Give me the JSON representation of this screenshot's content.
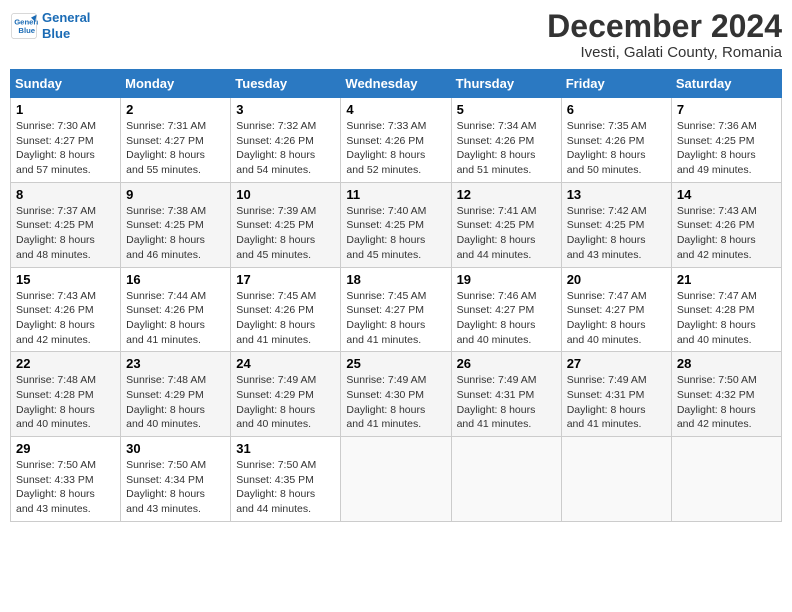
{
  "logo": {
    "line1": "General",
    "line2": "Blue"
  },
  "title": "December 2024",
  "location": "Ivesti, Galati County, Romania",
  "weekdays": [
    "Sunday",
    "Monday",
    "Tuesday",
    "Wednesday",
    "Thursday",
    "Friday",
    "Saturday"
  ],
  "weeks": [
    [
      {
        "day": "1",
        "sunrise": "7:30 AM",
        "sunset": "4:27 PM",
        "daylight": "8 hours and 57 minutes."
      },
      {
        "day": "2",
        "sunrise": "7:31 AM",
        "sunset": "4:27 PM",
        "daylight": "8 hours and 55 minutes."
      },
      {
        "day": "3",
        "sunrise": "7:32 AM",
        "sunset": "4:26 PM",
        "daylight": "8 hours and 54 minutes."
      },
      {
        "day": "4",
        "sunrise": "7:33 AM",
        "sunset": "4:26 PM",
        "daylight": "8 hours and 52 minutes."
      },
      {
        "day": "5",
        "sunrise": "7:34 AM",
        "sunset": "4:26 PM",
        "daylight": "8 hours and 51 minutes."
      },
      {
        "day": "6",
        "sunrise": "7:35 AM",
        "sunset": "4:26 PM",
        "daylight": "8 hours and 50 minutes."
      },
      {
        "day": "7",
        "sunrise": "7:36 AM",
        "sunset": "4:25 PM",
        "daylight": "8 hours and 49 minutes."
      }
    ],
    [
      {
        "day": "8",
        "sunrise": "7:37 AM",
        "sunset": "4:25 PM",
        "daylight": "8 hours and 48 minutes."
      },
      {
        "day": "9",
        "sunrise": "7:38 AM",
        "sunset": "4:25 PM",
        "daylight": "8 hours and 46 minutes."
      },
      {
        "day": "10",
        "sunrise": "7:39 AM",
        "sunset": "4:25 PM",
        "daylight": "8 hours and 45 minutes."
      },
      {
        "day": "11",
        "sunrise": "7:40 AM",
        "sunset": "4:25 PM",
        "daylight": "8 hours and 45 minutes."
      },
      {
        "day": "12",
        "sunrise": "7:41 AM",
        "sunset": "4:25 PM",
        "daylight": "8 hours and 44 minutes."
      },
      {
        "day": "13",
        "sunrise": "7:42 AM",
        "sunset": "4:25 PM",
        "daylight": "8 hours and 43 minutes."
      },
      {
        "day": "14",
        "sunrise": "7:43 AM",
        "sunset": "4:26 PM",
        "daylight": "8 hours and 42 minutes."
      }
    ],
    [
      {
        "day": "15",
        "sunrise": "7:43 AM",
        "sunset": "4:26 PM",
        "daylight": "8 hours and 42 minutes."
      },
      {
        "day": "16",
        "sunrise": "7:44 AM",
        "sunset": "4:26 PM",
        "daylight": "8 hours and 41 minutes."
      },
      {
        "day": "17",
        "sunrise": "7:45 AM",
        "sunset": "4:26 PM",
        "daylight": "8 hours and 41 minutes."
      },
      {
        "day": "18",
        "sunrise": "7:45 AM",
        "sunset": "4:27 PM",
        "daylight": "8 hours and 41 minutes."
      },
      {
        "day": "19",
        "sunrise": "7:46 AM",
        "sunset": "4:27 PM",
        "daylight": "8 hours and 40 minutes."
      },
      {
        "day": "20",
        "sunrise": "7:47 AM",
        "sunset": "4:27 PM",
        "daylight": "8 hours and 40 minutes."
      },
      {
        "day": "21",
        "sunrise": "7:47 AM",
        "sunset": "4:28 PM",
        "daylight": "8 hours and 40 minutes."
      }
    ],
    [
      {
        "day": "22",
        "sunrise": "7:48 AM",
        "sunset": "4:28 PM",
        "daylight": "8 hours and 40 minutes."
      },
      {
        "day": "23",
        "sunrise": "7:48 AM",
        "sunset": "4:29 PM",
        "daylight": "8 hours and 40 minutes."
      },
      {
        "day": "24",
        "sunrise": "7:49 AM",
        "sunset": "4:29 PM",
        "daylight": "8 hours and 40 minutes."
      },
      {
        "day": "25",
        "sunrise": "7:49 AM",
        "sunset": "4:30 PM",
        "daylight": "8 hours and 41 minutes."
      },
      {
        "day": "26",
        "sunrise": "7:49 AM",
        "sunset": "4:31 PM",
        "daylight": "8 hours and 41 minutes."
      },
      {
        "day": "27",
        "sunrise": "7:49 AM",
        "sunset": "4:31 PM",
        "daylight": "8 hours and 41 minutes."
      },
      {
        "day": "28",
        "sunrise": "7:50 AM",
        "sunset": "4:32 PM",
        "daylight": "8 hours and 42 minutes."
      }
    ],
    [
      {
        "day": "29",
        "sunrise": "7:50 AM",
        "sunset": "4:33 PM",
        "daylight": "8 hours and 43 minutes."
      },
      {
        "day": "30",
        "sunrise": "7:50 AM",
        "sunset": "4:34 PM",
        "daylight": "8 hours and 43 minutes."
      },
      {
        "day": "31",
        "sunrise": "7:50 AM",
        "sunset": "4:35 PM",
        "daylight": "8 hours and 44 minutes."
      },
      null,
      null,
      null,
      null
    ]
  ],
  "labels": {
    "sunrise": "Sunrise:",
    "sunset": "Sunset:",
    "daylight": "Daylight:"
  }
}
